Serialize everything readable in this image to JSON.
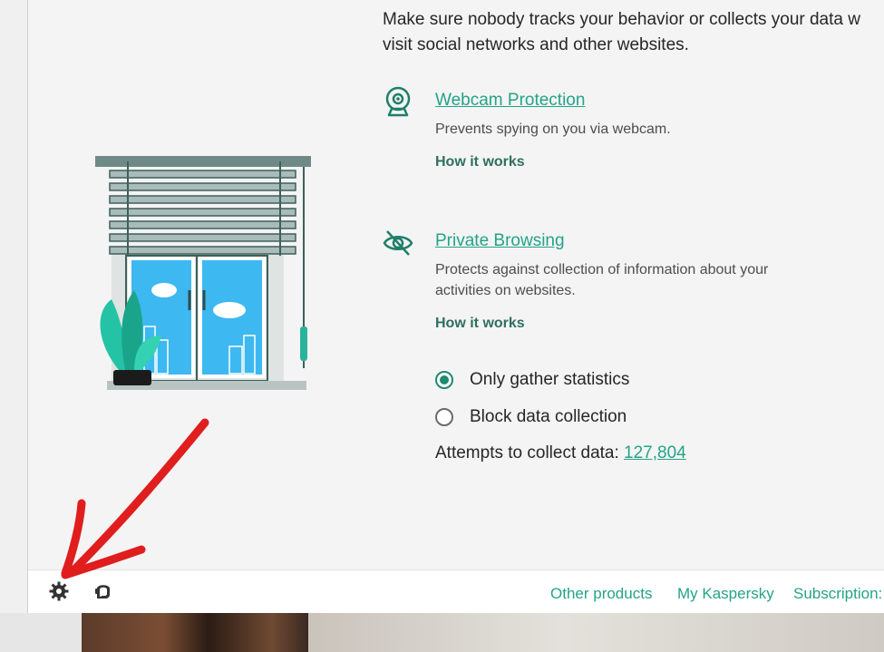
{
  "intro": {
    "line1": "Make sure nobody tracks your behavior or collects your data w",
    "line2": "visit social networks and other websites."
  },
  "webcam": {
    "icon": "webcam-icon",
    "title": "Webcam Protection",
    "description": "Prevents spying on you via webcam.",
    "how_it_works": "How it works"
  },
  "private_browsing": {
    "icon": "eye-slash-icon",
    "title": "Private Browsing",
    "description_line1": "Protects against collection of information about your",
    "description_line2": "activities on websites.",
    "how_it_works": "How it works"
  },
  "data_collection_mode": {
    "options": [
      {
        "label": "Only gather statistics",
        "selected": true
      },
      {
        "label": "Block data collection",
        "selected": false
      }
    ]
  },
  "attempts": {
    "label": "Attempts to collect data: ",
    "count": "127,804"
  },
  "footer": {
    "settings_icon": "gear-icon",
    "support_icon": "support-icon",
    "other_products": "Other products",
    "my_kaspersky": "My Kaspersky",
    "subscription": "Subscription:"
  },
  "colors": {
    "accent": "#23a388",
    "annotation_arrow": "#e01e1e"
  }
}
